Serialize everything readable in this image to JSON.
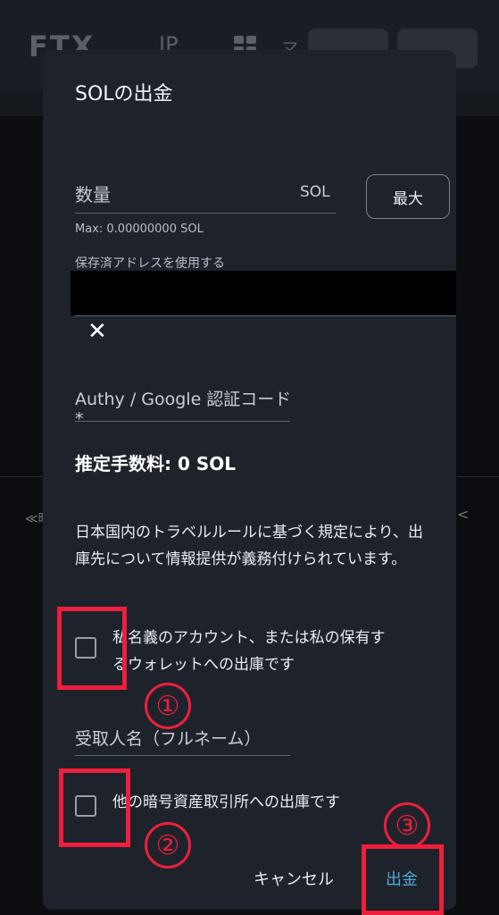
{
  "background": {
    "logo": "FTX",
    "region": "JP",
    "menu_fragment": "マ",
    "left_fragment": "≪時",
    "right_fragment": "<"
  },
  "modal": {
    "title": "SOLの出金",
    "amount": {
      "label": "数量",
      "unit": "SOL",
      "max_button": "最大",
      "max_info": "Max: 0.00000000 SOL"
    },
    "saved_address_label": "保存済アドレスを使用する",
    "close_icon": "close-icon",
    "auth_code_label": "Authy / Google 認証コード*",
    "fee": "推定手数料: 0 SOL",
    "notice": "日本国内のトラベルルールに基づく規定により、出庫先について情報提供が義務付けられています。",
    "checkbox_own": {
      "label": "私名義のアカウント、または私の保有するウォレットへの出庫です",
      "checked": false
    },
    "recipient_name_label": "受取人名（フルネーム）",
    "checkbox_exchange": {
      "label": "他の暗号資産取引所への出庫です",
      "checked": false
    },
    "cancel_button": "キャンセル",
    "submit_button": "出金"
  },
  "annotations": {
    "num1": "①",
    "num2": "②",
    "num3": "③",
    "color": "#ef1e3c"
  }
}
